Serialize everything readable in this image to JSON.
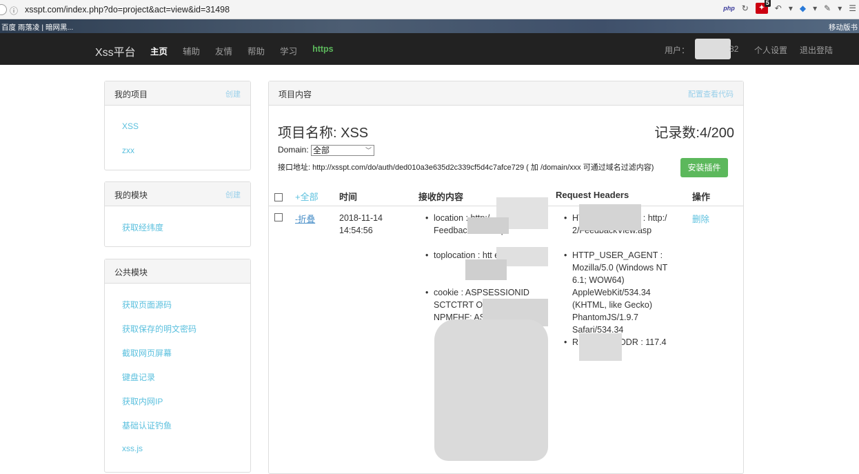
{
  "browser": {
    "url": "xsspt.com/index.php?do=project&act=view&id=31498",
    "php_label": "php",
    "badge_count": "5",
    "bookmarks_left": "百度   雨落凌 | 暗网黑...",
    "bookmarks_right": "移动版书"
  },
  "nav": {
    "brand": "Xss平台",
    "items": [
      "主页",
      "辅助",
      "友情",
      "帮助",
      "学习",
      "https"
    ],
    "user_label": "用户：",
    "user_suffix": "32",
    "settings": "个人设置",
    "logout": "退出登陆"
  },
  "sidebar": {
    "my_projects": {
      "title": "我的项目",
      "action": "创建",
      "items": [
        "XSS",
        "zxx"
      ]
    },
    "my_modules": {
      "title": "我的模块",
      "action": "创建",
      "items": [
        "获取经纬度"
      ]
    },
    "public_modules": {
      "title": "公共模块",
      "items": [
        "获取页面源码",
        "获取保存的明文密码",
        "截取网页屏幕",
        "键盘记录",
        "获取内网IP",
        "基础认证钓鱼",
        "xss.js"
      ]
    }
  },
  "content": {
    "header": "项目内容",
    "actions": [
      "配置",
      "查看代码"
    ],
    "project_name": "项目名称: XSS",
    "record_count": "记录数:4/200",
    "domain_label": "Domain:",
    "domain_value": "全部",
    "api_text": "接口地址: http://xsspt.com/do/auth/ded010a3e635d2c339cf5d4c7afce729 ( 加 /domain/xxx 可通过域名过滤内容)",
    "install_button": "安装插件",
    "columns": {
      "all": "+全部",
      "time": "时间",
      "content": "接收的内容",
      "headers": "Request Headers",
      "operation": "操作"
    },
    "row": {
      "toggle": "-折叠",
      "date": "2018-11-14",
      "time": "14:54:56",
      "content_items": [
        "location : http:/                   FeedbackView.asp",
        "toplocation : htt                   eedbackV",
        "cookie : ASPSESSIONID SCTCTRT         OHK                    EH                                                  BN           G NPMFHF: AS"
      ],
      "header_items": [
        "HTTP_REFERER : http:/                 2/FeedbackView.asp",
        "HTTP_USER_AGENT : Mozilla/5.0 (Windows NT 6.1; WOW64) AppleWebKit/534.34 (KHTML, like Gecko) PhantomJS/1.9.7 Safari/534.34",
        "REMOTE_ADDR : 117.4"
      ],
      "delete": "删除"
    }
  }
}
